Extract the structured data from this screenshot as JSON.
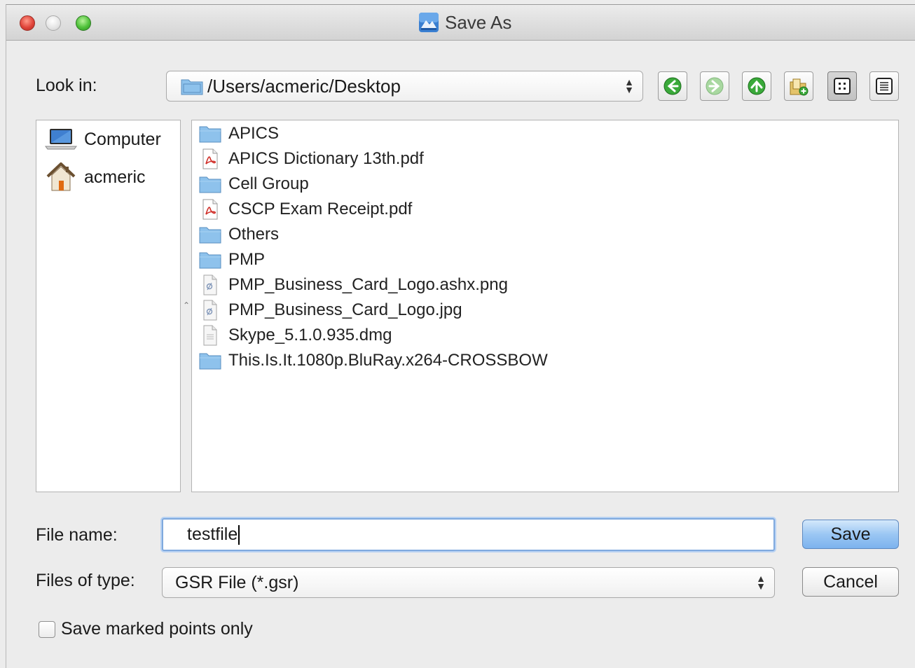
{
  "window": {
    "title": "Save As"
  },
  "look_in": {
    "label": "Look in:",
    "path": "/Users/acmeric/Desktop"
  },
  "toolbar": {
    "buttons": [
      "back-icon",
      "forward-icon",
      "up-icon",
      "new-folder-icon",
      "icon-view-icon",
      "list-view-icon"
    ]
  },
  "sidebar": {
    "items": [
      {
        "label": "Computer",
        "icon": "laptop-icon"
      },
      {
        "label": "acmeric",
        "icon": "home-icon"
      }
    ]
  },
  "files": [
    {
      "name": "APICS",
      "type": "folder"
    },
    {
      "name": "APICS Dictionary 13th.pdf",
      "type": "pdf"
    },
    {
      "name": "Cell Group",
      "type": "folder"
    },
    {
      "name": "CSCP Exam Receipt.pdf",
      "type": "pdf"
    },
    {
      "name": "Others",
      "type": "folder"
    },
    {
      "name": "PMP",
      "type": "folder"
    },
    {
      "name": "PMP_Business_Card_Logo.ashx.png",
      "type": "image"
    },
    {
      "name": "PMP_Business_Card_Logo.jpg",
      "type": "image"
    },
    {
      "name": "Skype_5.1.0.935.dmg",
      "type": "file"
    },
    {
      "name": "This.Is.It.1080p.BluRay.x264-CROSSBOW",
      "type": "folder"
    }
  ],
  "file_name": {
    "label": "File name:",
    "value": "testfile"
  },
  "file_type": {
    "label": "Files of type:",
    "value": "GSR File (*.gsr)"
  },
  "buttons": {
    "save": "Save",
    "cancel": "Cancel"
  },
  "options": {
    "marked_points_label": "Save marked points only",
    "marked_points_checked": false
  },
  "colors": {
    "default_button": "#9bc7f3",
    "focus_ring": "#7fa9de",
    "folder": "#8ec2ec"
  }
}
